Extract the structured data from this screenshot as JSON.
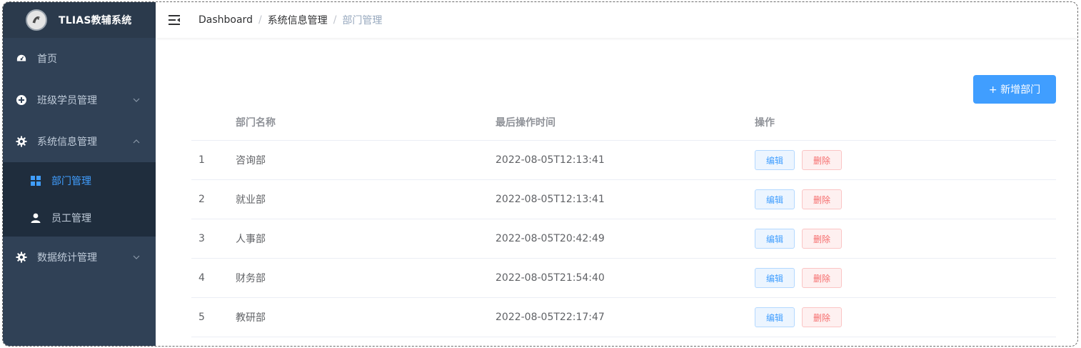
{
  "app": {
    "title": "TLIAS教辅系统"
  },
  "sidebar": {
    "items": [
      {
        "label": "首页",
        "icon": "dashboard-icon"
      },
      {
        "label": "班级学员管理",
        "icon": "plus-circle-icon",
        "expanded": false
      },
      {
        "label": "系统信息管理",
        "icon": "gear-icon",
        "expanded": true,
        "children": [
          {
            "label": "部门管理",
            "icon": "grid-icon",
            "active": true
          },
          {
            "label": "员工管理",
            "icon": "user-icon"
          }
        ]
      },
      {
        "label": "数据统计管理",
        "icon": "gear-icon",
        "expanded": false
      }
    ]
  },
  "breadcrumb": [
    "Dashboard",
    "系统信息管理",
    "部门管理"
  ],
  "toolbar": {
    "add_label": "+ 新增部门"
  },
  "table": {
    "columns": [
      "部门名称",
      "最后操作时间",
      "操作"
    ],
    "rows": [
      {
        "idx": "1",
        "name": "咨询部",
        "time": "2022-08-05T12:13:41"
      },
      {
        "idx": "2",
        "name": "就业部",
        "time": "2022-08-05T12:13:41"
      },
      {
        "idx": "3",
        "name": "人事部",
        "time": "2022-08-05T20:42:49"
      },
      {
        "idx": "4",
        "name": "财务部",
        "time": "2022-08-05T21:54:40"
      },
      {
        "idx": "5",
        "name": "教研部",
        "time": "2022-08-05T22:17:47"
      }
    ],
    "edit_label": "编辑",
    "delete_label": "删除"
  },
  "colors": {
    "sidebar_bg": "#304156",
    "submenu_bg": "#1f2d3d",
    "primary": "#409eff",
    "danger": "#f56c6c"
  }
}
